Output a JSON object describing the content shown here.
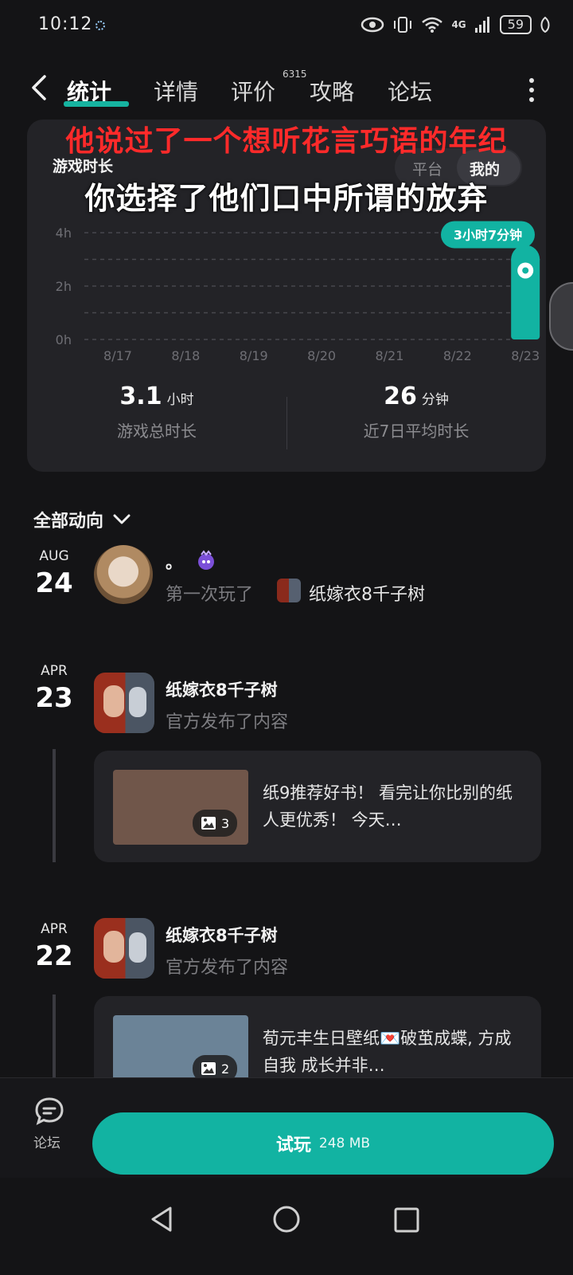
{
  "status_bar": {
    "time": "10:12",
    "network": "4G",
    "battery": "59"
  },
  "nav": {
    "tabs": [
      {
        "label": "统计",
        "active": true
      },
      {
        "label": "详情"
      },
      {
        "label": "评价",
        "badge": "6315"
      },
      {
        "label": "攻略"
      },
      {
        "label": "论坛"
      }
    ]
  },
  "overlay": {
    "line1": "他说过了一个想听花言巧语的年纪",
    "line2": "你选择了他们口中所谓的放弃"
  },
  "stats_card": {
    "title": "游戏时长",
    "toggle": {
      "left": "平台",
      "right": "我的"
    },
    "highlight_label": "3小时7分钟",
    "summary": [
      {
        "value": "3.1",
        "unit": "小时",
        "label": "游戏总时长"
      },
      {
        "value": "26",
        "unit": "分钟",
        "label": "近7日平均时长"
      }
    ]
  },
  "chart_data": {
    "type": "bar",
    "categories": [
      "8/17",
      "8/18",
      "8/19",
      "8/20",
      "8/21",
      "8/22",
      "8/23"
    ],
    "values": [
      0,
      0,
      0,
      0,
      0,
      0,
      3.12
    ],
    "ylim": [
      0,
      4
    ],
    "yticks": [
      "0h",
      "2h",
      "4h"
    ],
    "annotation": {
      "category": "8/23",
      "text": "3小时7分钟"
    },
    "grid": true,
    "colors": {
      "bar": "#12b3a2",
      "grid": "#48484e",
      "tick": "#6e6e74"
    }
  },
  "feed": {
    "filter_label": "全部动向",
    "items": [
      {
        "month": "AUG",
        "day": "24",
        "name": "。",
        "sub_prefix": "第一次玩了",
        "game": "纸嫁衣8千子树"
      },
      {
        "month": "APR",
        "day": "23",
        "name": "纸嫁衣8千子树",
        "sub": "官方发布了内容",
        "post": {
          "text": "纸9推荐好书！ 看完让你比别的纸人更优秀！ 今天…",
          "image_count": "3",
          "thumb_color": "#70564a"
        }
      },
      {
        "month": "APR",
        "day": "22",
        "name": "纸嫁衣8千子树",
        "sub": "官方发布了内容",
        "post": {
          "text": "荀元丰生日壁纸💌破茧成蝶, 方成自我 成长并非…",
          "image_count": "2",
          "thumb_color": "#6b8397"
        }
      }
    ]
  },
  "bottom": {
    "forum_label": "论坛",
    "play_label": "试玩",
    "play_size": "248 MB"
  },
  "colors": {
    "accent": "#12b3a2",
    "background": "#141416",
    "card": "#232327",
    "overlay_red": "#ff2a2a"
  }
}
